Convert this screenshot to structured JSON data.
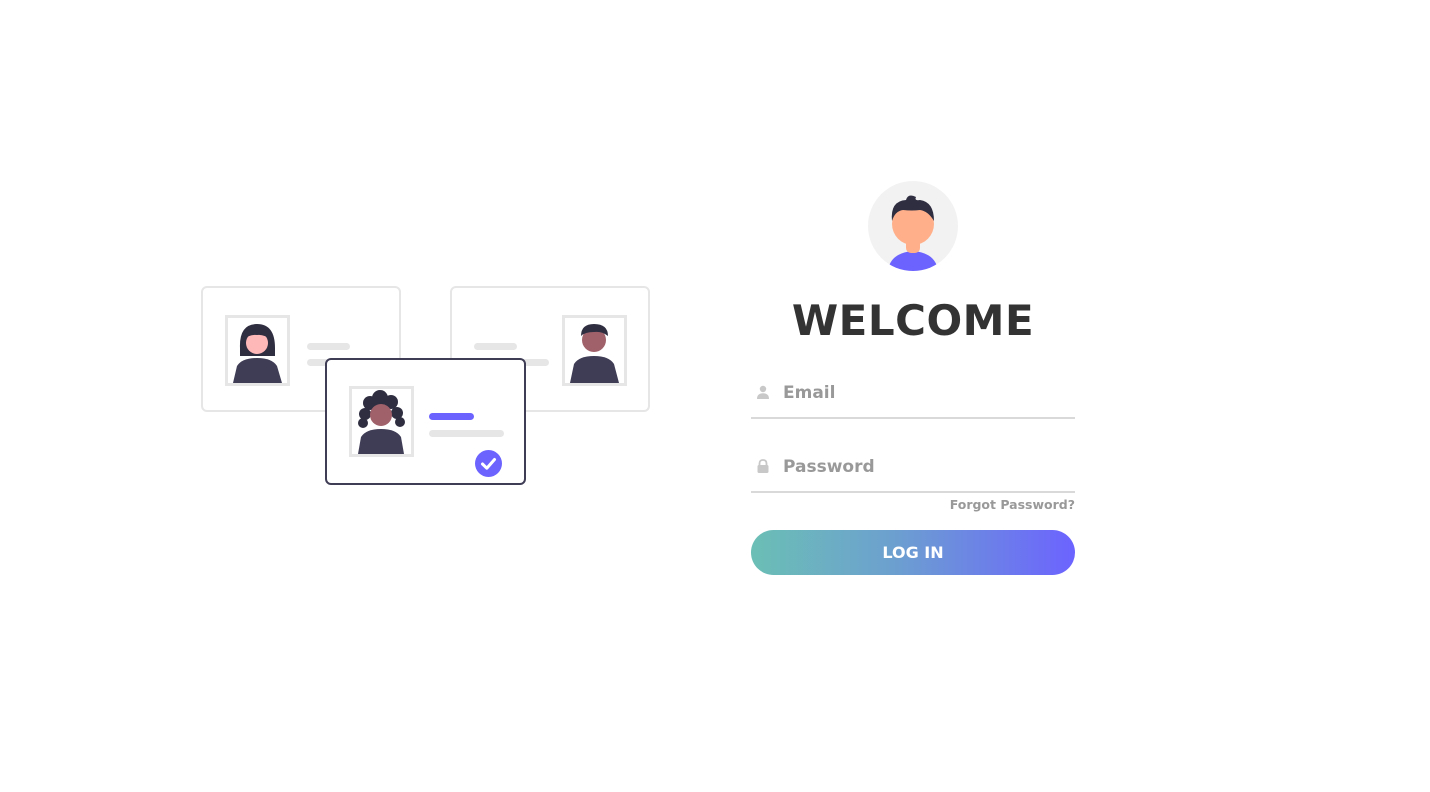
{
  "login": {
    "title": "WELCOME",
    "email": {
      "placeholder": "Email",
      "value": "",
      "icon": "user-icon"
    },
    "password": {
      "placeholder": "Password",
      "value": "",
      "icon": "lock-icon"
    },
    "forgot_label": "Forgot Password?",
    "submit_label": "LOG IN",
    "avatar_icon": "user-avatar-icon"
  },
  "illustration": {
    "icon": "id-cards-illustration",
    "selected_card_icon": "check-circle-icon"
  },
  "colors": {
    "accent": "#6c63ff",
    "gradient_start": "#6bbfb5",
    "gradient_end": "#6c63ff",
    "title": "#333333",
    "muted": "#999999",
    "divider": "#d9d9d9"
  }
}
